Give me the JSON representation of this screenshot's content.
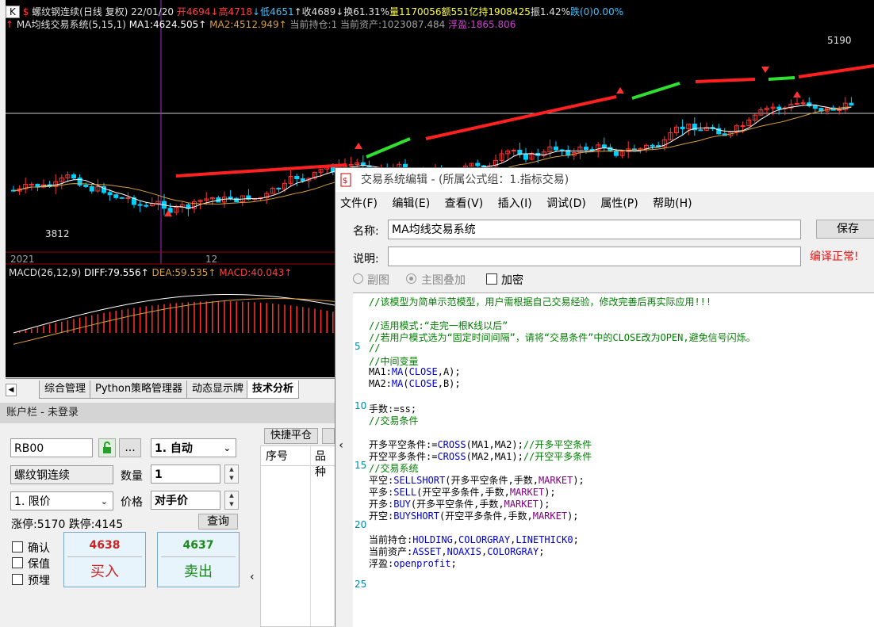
{
  "chart": {
    "header_line1": [
      {
        "t": "K",
        "c": "#000000"
      },
      {
        "t": "  $",
        "c": "#ff3333"
      },
      {
        "t": "  螺纹钢连续(日线 复权)",
        "c": "#e0e0e0"
      },
      {
        "t": "  22/01/20",
        "c": "#e0e0e0"
      },
      {
        "t": "  开4694",
        "c": "#ff4040"
      },
      {
        "t": "↓高4718",
        "c": "#ff4040"
      },
      {
        "t": "↓低4651",
        "c": "#40c0ff"
      },
      {
        "t": "↑收4689",
        "c": "#e0e0e0"
      },
      {
        "t": "↓换61.31%",
        "c": "#e0e0e0"
      },
      {
        "t": "量1170056",
        "c": "#ffff40"
      },
      {
        "t": "额551亿",
        "c": "#ffff40"
      },
      {
        "t": "持1908425",
        "c": "#ffff40"
      },
      {
        "t": "振1.42%",
        "c": "#e0e0e0"
      },
      {
        "t": "跌(0)0.00%",
        "c": "#40c0ff"
      }
    ],
    "header_line2": [
      {
        "t": "↑",
        "c": "#ff3333"
      },
      {
        "t": " MA均线交易系统(5,15,1)",
        "c": "#e0e0e0"
      },
      {
        "t": " MA1:4624.505↑",
        "c": "#ffffff"
      },
      {
        "t": " MA2:4512.949↑",
        "c": "#d8a040"
      },
      {
        "t": " 当前持仓:1",
        "c": "#a0a0a0"
      },
      {
        "t": " 当前资产:1023087.484",
        "c": "#a0a0a0"
      },
      {
        "t": " 浮盈:1865.806",
        "c": "#d040d0"
      }
    ],
    "price_high_label": "5190",
    "price_low_label": "3812",
    "axis_labels": [
      "2021",
      "12"
    ],
    "macd_header": [
      {
        "t": "MACD(26,12,9)",
        "c": "#e0e0e0"
      },
      {
        "t": " DIFF:79.556↑",
        "c": "#ffffff"
      },
      {
        "t": " DEA:59.535↑",
        "c": "#d8a040"
      },
      {
        "t": " MACD:40.043↑",
        "c": "#ff4040"
      }
    ],
    "colors": {
      "up": "#ff3333",
      "down": "#00d0ff",
      "ma1": "#ffffff",
      "ma2": "#d8a040",
      "long": "#ff2020",
      "short": "#30e030"
    }
  },
  "tabs": [
    "综合管理",
    "Python策略管理器",
    "动态显示牌",
    "技术分析"
  ],
  "account": {
    "title": "账户栏 - 未登录",
    "contract_code": "RB00",
    "mode": "1. 自动",
    "contract_name": "螺纹钢连续",
    "qty_label": "数量",
    "qty_value": "1",
    "price_type": "1. 限价",
    "price_label": "价格",
    "price_value": "对手价",
    "limit_text": "涨停:5170 跌停:4145",
    "query_label": "查询",
    "more_label": "...",
    "checks": [
      "确认",
      "保值",
      "预埋"
    ],
    "buy_price": "4638",
    "buy_label": "买入",
    "sell_price": "4637",
    "sell_label": "卖出",
    "quick_close_label": "快捷平仓",
    "col_seq": "序号",
    "col_name": "品种"
  },
  "dialog": {
    "title": "交易系统编辑 - (所属公式组：1.指标交易)",
    "menu": [
      "文件(F)",
      "编辑(E)",
      "查看(V)",
      "插入(I)",
      "调试(D)",
      "属性(P)",
      "帮助(H)"
    ],
    "name_label": "名称:",
    "name_value": "MA均线交易系统",
    "desc_label": "说明:",
    "save_label": "保存",
    "compile_status": "编译正常!",
    "radio_sub": "副图",
    "radio_main": "主图叠加",
    "encrypt_label": "加密",
    "line_numbers": [
      "5",
      "10",
      "15",
      "20",
      "25"
    ],
    "code": [
      [
        {
          "t": "//该模型为简单示范模型，用户需根据自己交易经验，修改完善后再实际应用!!!",
          "c": "#008000"
        }
      ],
      [],
      [
        {
          "t": "//适用模式:“走完一根K线以后”",
          "c": "#008000"
        }
      ],
      [
        {
          "t": "//若用户模式选为“固定时间间隔”，请将“交易条件”中的CLOSE改为OPEN,避免信号闪烁。",
          "c": "#008000"
        }
      ],
      [
        {
          "t": "//",
          "c": "#008000"
        }
      ],
      [
        {
          "t": "//中间变量",
          "c": "#008000"
        }
      ],
      [
        {
          "t": "MA1:",
          "c": "#000000"
        },
        {
          "t": "MA",
          "c": "#0000cc"
        },
        {
          "t": "(",
          "c": "#000000"
        },
        {
          "t": "CLOSE",
          "c": "#0000cc"
        },
        {
          "t": ",A);",
          "c": "#000000"
        }
      ],
      [
        {
          "t": "MA2:",
          "c": "#000000"
        },
        {
          "t": "MA",
          "c": "#0000cc"
        },
        {
          "t": "(",
          "c": "#000000"
        },
        {
          "t": "CLOSE",
          "c": "#0000cc"
        },
        {
          "t": ",B);",
          "c": "#000000"
        }
      ],
      [],
      [
        {
          "t": "手数:=ss;",
          "c": "#000000"
        }
      ],
      [
        {
          "t": "//交易条件",
          "c": "#008000"
        }
      ],
      [],
      [
        {
          "t": "开多平空条件:=",
          "c": "#000000"
        },
        {
          "t": "CROSS",
          "c": "#0000cc"
        },
        {
          "t": "(MA1,MA2);",
          "c": "#000000"
        },
        {
          "t": "//开多平空条件",
          "c": "#008000"
        }
      ],
      [
        {
          "t": "开空平多条件:=",
          "c": "#000000"
        },
        {
          "t": "CROSS",
          "c": "#0000cc"
        },
        {
          "t": "(MA2,MA1);",
          "c": "#000000"
        },
        {
          "t": "//开空平多条件",
          "c": "#008000"
        }
      ],
      [
        {
          "t": "//交易系统",
          "c": "#008000"
        }
      ],
      [
        {
          "t": "平空:",
          "c": "#000000"
        },
        {
          "t": "SELLSHORT",
          "c": "#0000cc"
        },
        {
          "t": "(开多平空条件,手数,",
          "c": "#000000"
        },
        {
          "t": "MARKET",
          "c": "#800080"
        },
        {
          "t": ");",
          "c": "#000000"
        }
      ],
      [
        {
          "t": "平多:",
          "c": "#000000"
        },
        {
          "t": "SELL",
          "c": "#0000cc"
        },
        {
          "t": "(开空平多条件,手数,",
          "c": "#000000"
        },
        {
          "t": "MARKET",
          "c": "#800080"
        },
        {
          "t": ");",
          "c": "#000000"
        }
      ],
      [
        {
          "t": "开多:",
          "c": "#000000"
        },
        {
          "t": "BUY",
          "c": "#0000cc"
        },
        {
          "t": "(开多平空条件,手数,",
          "c": "#000000"
        },
        {
          "t": "MARKET",
          "c": "#800080"
        },
        {
          "t": ");",
          "c": "#000000"
        }
      ],
      [
        {
          "t": "开空:",
          "c": "#000000"
        },
        {
          "t": "BUYSHORT",
          "c": "#0000cc"
        },
        {
          "t": "(开空平多条件,手数,",
          "c": "#000000"
        },
        {
          "t": "MARKET",
          "c": "#800080"
        },
        {
          "t": ");",
          "c": "#000000"
        }
      ],
      [],
      [
        {
          "t": "当前持仓:",
          "c": "#000000"
        },
        {
          "t": "HOLDING",
          "c": "#0000cc"
        },
        {
          "t": ",",
          "c": "#000000"
        },
        {
          "t": "COLORGRAY",
          "c": "#0000cc"
        },
        {
          "t": ",",
          "c": "#000000"
        },
        {
          "t": "LINETHICK0",
          "c": "#0000cc"
        },
        {
          "t": ";",
          "c": "#000000"
        }
      ],
      [
        {
          "t": "当前资产:",
          "c": "#000000"
        },
        {
          "t": "ASSET",
          "c": "#0000cc"
        },
        {
          "t": ",",
          "c": "#000000"
        },
        {
          "t": "NOAXIS",
          "c": "#0000cc"
        },
        {
          "t": ",",
          "c": "#000000"
        },
        {
          "t": "COLORGRAY",
          "c": "#0000cc"
        },
        {
          "t": ";",
          "c": "#000000"
        }
      ],
      [
        {
          "t": "浮盈:",
          "c": "#000000"
        },
        {
          "t": "openprofit",
          "c": "#0000cc"
        },
        {
          "t": ";",
          "c": "#000000"
        }
      ]
    ]
  }
}
